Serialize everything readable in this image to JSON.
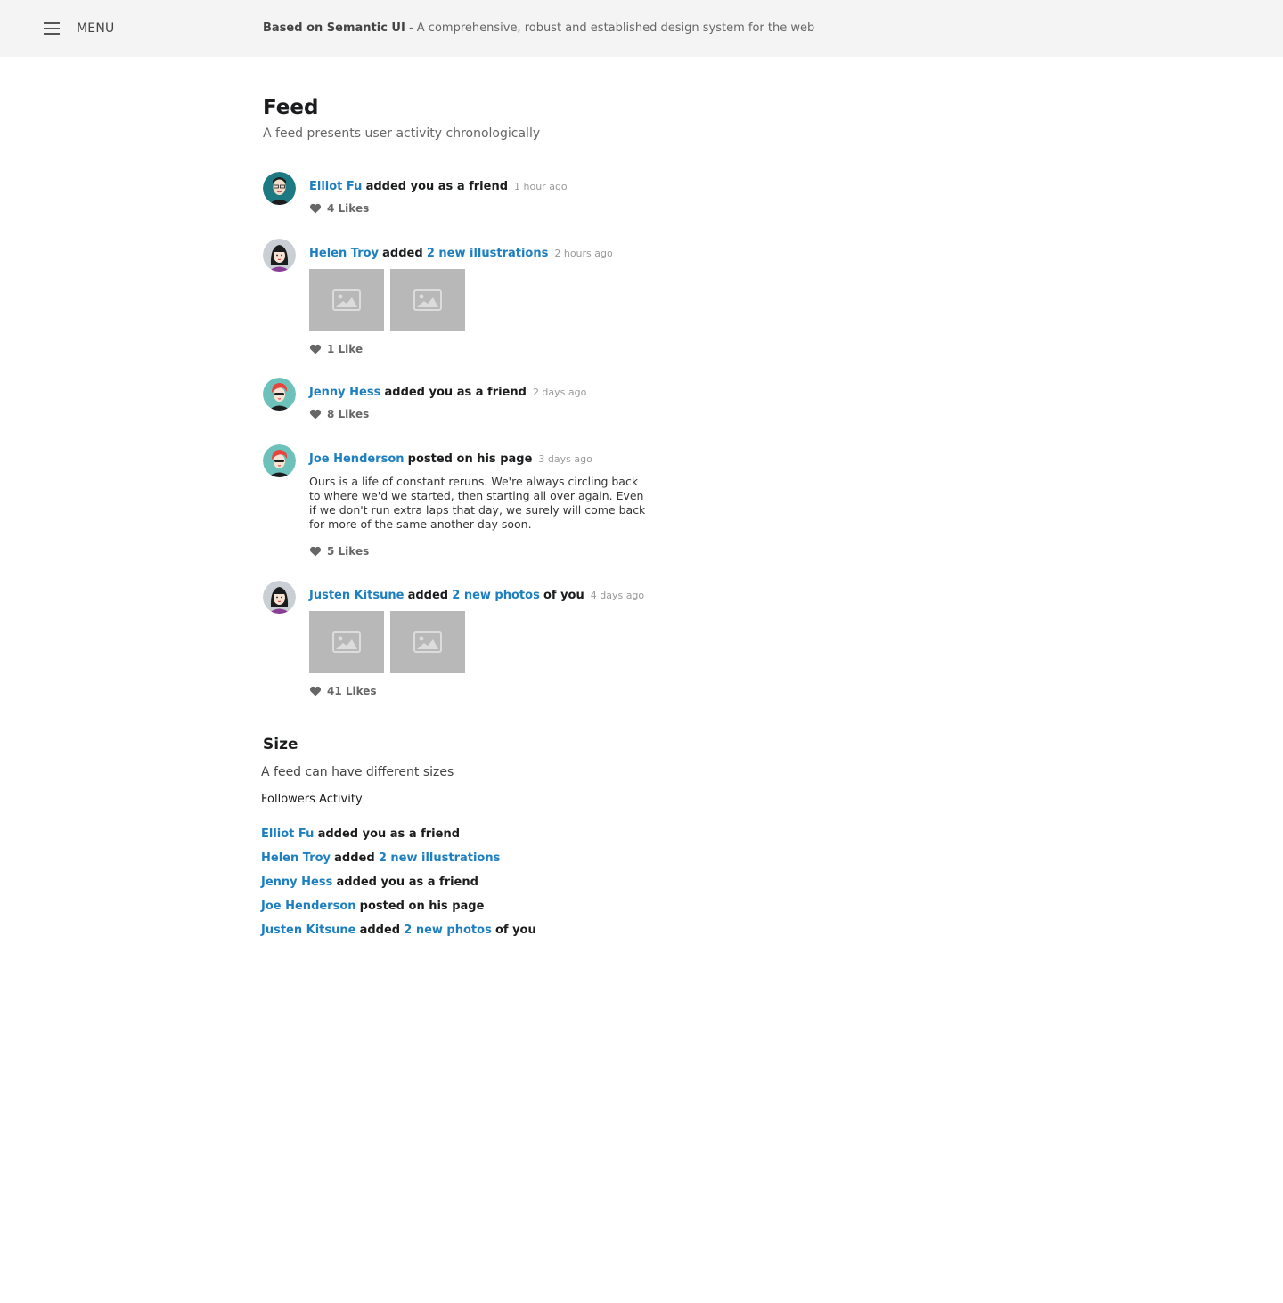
{
  "header": {
    "menu_label": "MENU",
    "tagline_bold": "Based on Semantic UI",
    "tagline_rest": " - A comprehensive, robust and established design system for the web"
  },
  "page": {
    "title": "Feed",
    "subtitle": "A feed presents user activity chronologically"
  },
  "feed": [
    {
      "user": "Elliot Fu",
      "action": "added you as a friend",
      "date": "1 hour ago",
      "likes": "4 Likes"
    },
    {
      "user": "Helen Troy",
      "action": "added",
      "object": "2 new illustrations",
      "date": "2 hours ago",
      "likes": "1 Like"
    },
    {
      "user": "Jenny Hess",
      "action": "added you as a friend",
      "date": "2 days ago",
      "likes": "8 Likes"
    },
    {
      "user": "Joe Henderson",
      "action": "posted on his page",
      "date": "3 days ago",
      "text": "Ours is a life of constant reruns. We're always circling back to where we'd we started, then starting all over again. Even if we don't run extra laps that day, we surely will come back for more of the same another day soon.",
      "likes": "5 Likes"
    },
    {
      "user": "Justen Kitsune",
      "action": "added",
      "object": "2 new photos",
      "suffix": "of you",
      "date": "4 days ago",
      "likes": "41 Likes"
    }
  ],
  "size_section": {
    "title": "Size",
    "subtitle": "A feed can have different sizes",
    "feed_title": "Followers Activity",
    "rows": [
      {
        "user": "Elliot Fu",
        "action": "added you as a friend"
      },
      {
        "user": "Helen Troy",
        "action": "added",
        "object": "2 new illustrations"
      },
      {
        "user": "Jenny Hess",
        "action": "added you as a friend"
      },
      {
        "user": "Joe Henderson",
        "action": "posted on his page"
      },
      {
        "user": "Justen Kitsune",
        "action": "added",
        "object": "2 new photos",
        "suffix": "of you"
      }
    ]
  },
  "colors": {
    "link": "#1e7fc0",
    "header_bg": "#f4f4f4",
    "placeholder": "#b8b8b8"
  }
}
